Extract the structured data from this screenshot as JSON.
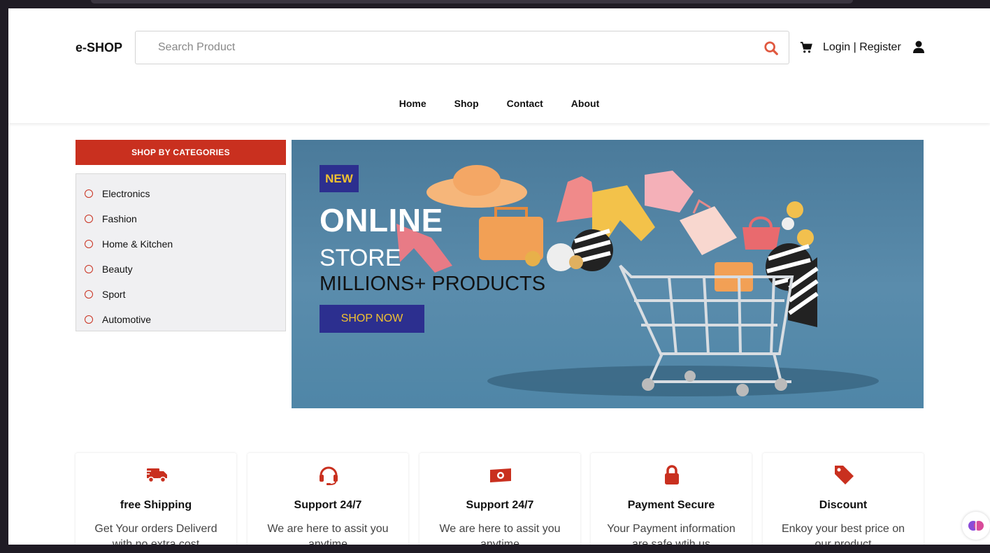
{
  "header": {
    "logo": "e-SHOP",
    "search_placeholder": "Search Product",
    "auth_label": "Login | Register"
  },
  "nav": [
    {
      "label": "Home"
    },
    {
      "label": "Shop"
    },
    {
      "label": "Contact"
    },
    {
      "label": "About"
    }
  ],
  "sidebar": {
    "title": "SHOP BY CATEGORIES",
    "items": [
      {
        "label": "Electronics"
      },
      {
        "label": "Fashion"
      },
      {
        "label": "Home & Kitchen"
      },
      {
        "label": "Beauty"
      },
      {
        "label": "Sport"
      },
      {
        "label": "Automotive"
      }
    ]
  },
  "banner": {
    "badge": "NEW",
    "headline": "ONLINE",
    "subheadline": "STORE",
    "tagline": "MILLIONS+ PRODUCTS",
    "cta": "SHOP NOW"
  },
  "features": [
    {
      "icon": "truck-icon",
      "title": "free Shipping",
      "desc": "Get Your orders Deliverd with no extra cost"
    },
    {
      "icon": "headset-icon",
      "title": "Support 24/7",
      "desc": "We are here to assit you anytime"
    },
    {
      "icon": "money-icon",
      "title": "Support 24/7",
      "desc": "We are here to assit you anytime"
    },
    {
      "icon": "lock-icon",
      "title": "Payment Secure",
      "desc": "Your Payment information are safe wtih us"
    },
    {
      "icon": "tag-icon",
      "title": "Discount",
      "desc": "Enkoy your best price on our product"
    }
  ],
  "colors": {
    "accent": "#c9301f",
    "primary": "#2c2f8f",
    "badge_text": "#f2c230",
    "banner_bg": "#4f86a7"
  }
}
